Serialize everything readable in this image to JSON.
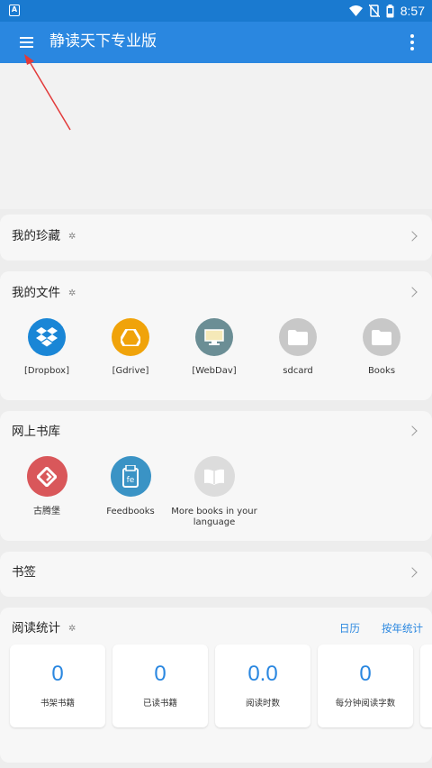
{
  "statusbar": {
    "time": "8:57",
    "left_icon": "A"
  },
  "appbar": {
    "title": "静读天下专业版"
  },
  "favorites": {
    "title": "我的珍藏"
  },
  "my_files": {
    "title": "我的文件",
    "items": [
      {
        "label": "[Dropbox]",
        "icon": "dropbox-icon",
        "color": "#1a86d6"
      },
      {
        "label": "[Gdrive]",
        "icon": "gdrive-icon",
        "color": "#f0a30a"
      },
      {
        "label": "[WebDav]",
        "icon": "webdav-icon",
        "color": "#6b8e95"
      },
      {
        "label": "sdcard",
        "icon": "folder-icon",
        "color": "#c8c8c8"
      },
      {
        "label": "Books",
        "icon": "folder-icon",
        "color": "#c8c8c8"
      }
    ]
  },
  "online_library": {
    "title": "网上书库",
    "items": [
      {
        "label": "古腾堡",
        "icon": "gutenberg-icon",
        "color": "#d9575a"
      },
      {
        "label": "Feedbooks",
        "icon": "feedbooks-icon",
        "color": "#3a93c5"
      },
      {
        "label": "More books in your language",
        "icon": "book-icon",
        "color": "#dcdcdc"
      }
    ]
  },
  "bookmarks": {
    "title": "书签"
  },
  "reading_stats": {
    "title": "阅读统计",
    "calendar_label": "日历",
    "yearly_label": "按年统计",
    "stats": [
      {
        "value": "0",
        "caption": "书架书籍"
      },
      {
        "value": "0",
        "caption": "已读书籍"
      },
      {
        "value": "0.0",
        "caption": "阅读时数"
      },
      {
        "value": "0",
        "caption": "每分钟阅读字数"
      }
    ]
  }
}
